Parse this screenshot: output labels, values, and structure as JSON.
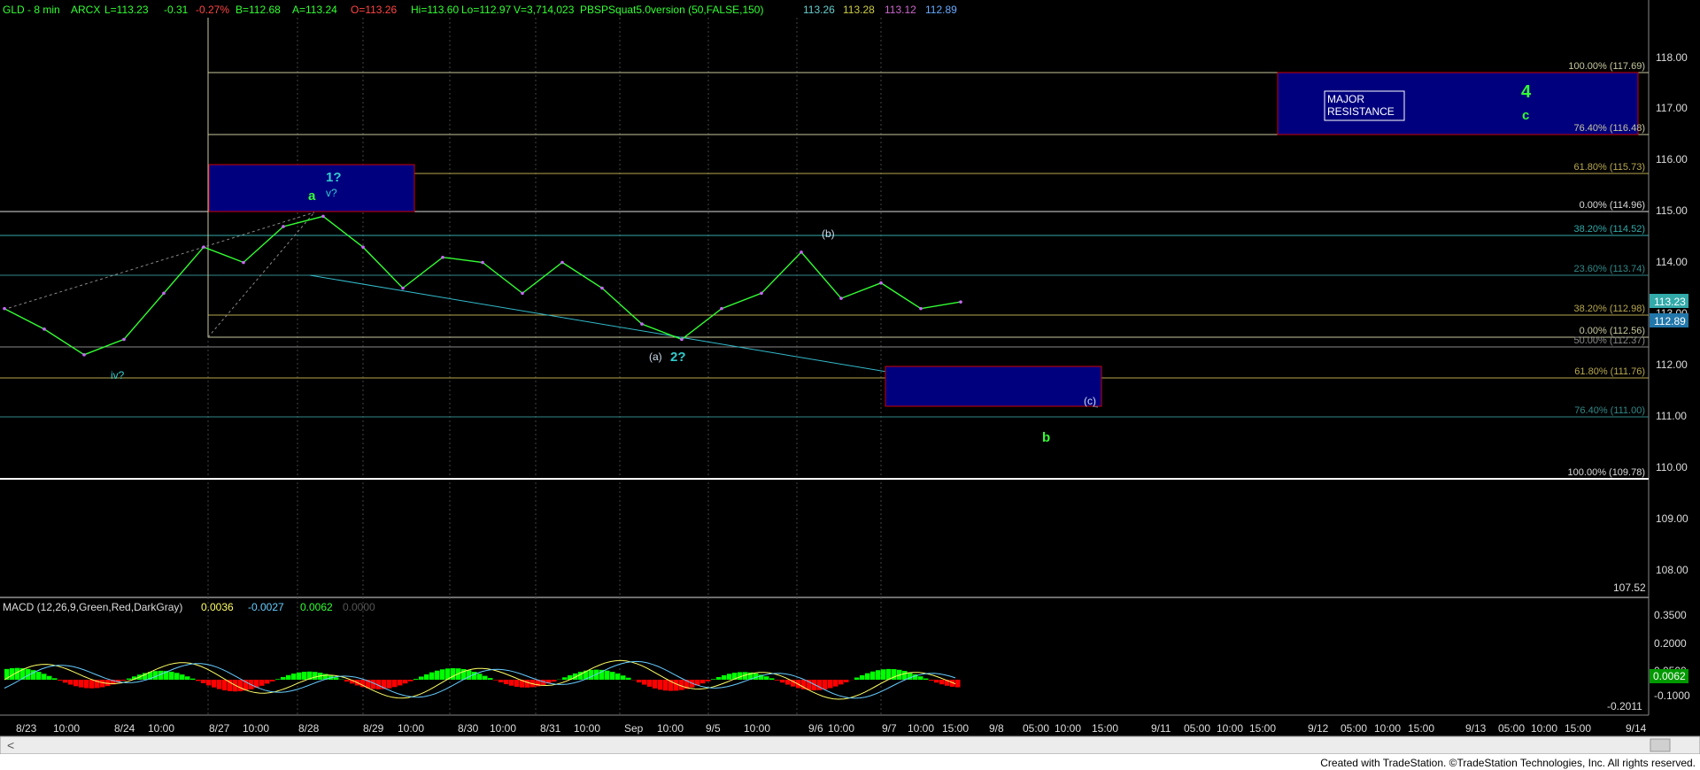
{
  "header": {
    "symbol": "GLD - 8 min",
    "exchange": "ARCX",
    "last": "L=113.23",
    "change": "-0.31",
    "change_pct": "-0.27%",
    "bid": "B=112.68",
    "ask": "A=113.24",
    "open": "O=113.26",
    "hi": "Hi=113.60",
    "lo": "Lo=112.97",
    "volume": "V=3,714,023",
    "study": "PBSPSquat5.0version (50,FALSE,150)",
    "study_values": [
      "113.26",
      "113.28",
      "113.12",
      "112.89"
    ]
  },
  "macd_header": {
    "label": "MACD (12,26,9,Green,Red,DarkGray)",
    "values": [
      "0.0036",
      "-0.0027",
      "0.0062",
      "0.0000"
    ]
  },
  "price_axis": {
    "ticks": [
      "118.00",
      "117.00",
      "116.00",
      "115.00",
      "114.00",
      "113.00",
      "112.00",
      "111.00",
      "110.00",
      "109.00",
      "108.00"
    ],
    "bottom_label": "107.52",
    "last_tag": "113.23",
    "second_tag": "112.89"
  },
  "macd_axis": {
    "ticks": [
      "0.3500",
      "0.2000",
      "0.0500",
      "-0.1000"
    ],
    "bottom_label": "-0.2011",
    "last_tag": "0.0062"
  },
  "time_axis": [
    "8/23",
    "10:00",
    "8/24",
    "10:00",
    "8/27",
    "10:00",
    "8/28",
    "8/29",
    "10:00",
    "8/30",
    "10:00",
    "8/31",
    "10:00",
    "Sep",
    "10:00",
    "9/5",
    "10:00",
    "9/6",
    "10:00",
    "9/7",
    "10:00",
    "15:00",
    "9/8",
    "05:00",
    "10:00",
    "15:00",
    "9/11",
    "05:00",
    "10:00",
    "15:00",
    "9/12",
    "05:00",
    "10:00",
    "15:00",
    "9/13",
    "05:00",
    "10:00",
    "15:00",
    "9/14"
  ],
  "fib_labels": [
    "100.00% (117.69)",
    "76.40% (116.48)",
    "61.80% (115.73)",
    "0.00% (114.96)",
    "38.20% (114.52)",
    "23.60% (113.74)",
    "38.20% (112.98)",
    "0.00% (112.56)",
    "50.00% (112.37)",
    "61.80% (111.76)",
    "76.40% (111.00)",
    "100.00% (109.78)"
  ],
  "wave_labels": {
    "iv": "iv?",
    "one": "1?",
    "v": "v?",
    "a": "a",
    "paren_a": "(a)",
    "two": "2?",
    "paren_b": "(b)",
    "paren_c": "(c)",
    "b": "b",
    "four": "4",
    "c": "c"
  },
  "resistance_label_1": "MAJOR",
  "resistance_label_2": "RESISTANCE",
  "footer": "Created with TradeStation. ©TradeStation Technologies, Inc. All rights reserved.",
  "colors": {
    "background": "#000000",
    "price": "#33ff33",
    "fib_line": "#cccc88",
    "trend_line": "#33bbcc",
    "box_fill": "#00007f",
    "box_border": "#cc0000",
    "wave_cyan": "#33cccc",
    "wave_green": "#33ff33",
    "macd_hist_pos": "#00ff00",
    "macd_hist_neg": "#ff0000",
    "macd_line": "#ffff66",
    "signal_line": "#66ccff"
  },
  "chart_data": {
    "type": "line",
    "title": "GLD - 8 min",
    "ylim": [
      107.52,
      118.6
    ],
    "series": [
      {
        "name": "GLD",
        "values": [
          {
            "x": "8/23 09:30",
            "y": 113.1
          },
          {
            "x": "8/23 13:00",
            "y": 112.7
          },
          {
            "x": "8/24 09:30",
            "y": 112.2
          },
          {
            "x": "8/24 10:30",
            "y": 112.5
          },
          {
            "x": "8/24 14:00",
            "y": 113.4
          },
          {
            "x": "8/24 15:00",
            "y": 114.3
          },
          {
            "x": "8/27 09:30",
            "y": 114.0
          },
          {
            "x": "8/27 13:00",
            "y": 114.7
          },
          {
            "x": "8/28 10:00",
            "y": 114.9
          },
          {
            "x": "8/28 14:00",
            "y": 114.3
          },
          {
            "x": "8/29 10:00",
            "y": 113.5
          },
          {
            "x": "8/29 14:00",
            "y": 114.1
          },
          {
            "x": "8/30 10:00",
            "y": 114.0
          },
          {
            "x": "8/30 14:00",
            "y": 113.4
          },
          {
            "x": "8/31 10:00",
            "y": 114.0
          },
          {
            "x": "8/31 14:00",
            "y": 113.5
          },
          {
            "x": "Sep 10:00",
            "y": 112.8
          },
          {
            "x": "Sep 14:00",
            "y": 112.5
          },
          {
            "x": "9/5 10:00",
            "y": 113.1
          },
          {
            "x": "9/5 14:00",
            "y": 113.4
          },
          {
            "x": "9/6 10:00",
            "y": 114.2
          },
          {
            "x": "9/6 14:00",
            "y": 113.3
          },
          {
            "x": "9/7 10:00",
            "y": 113.6
          },
          {
            "x": "9/7 14:00",
            "y": 113.1
          },
          {
            "x": "9/7 15:30",
            "y": 113.23
          }
        ]
      }
    ]
  }
}
